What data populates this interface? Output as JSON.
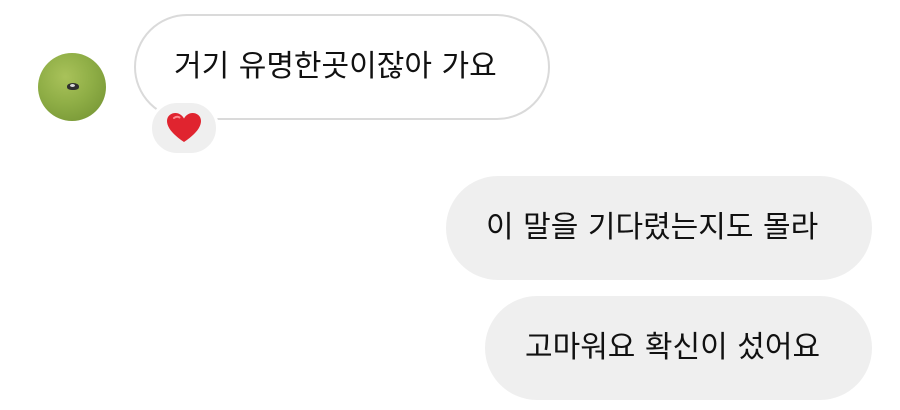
{
  "conversation": {
    "incoming": {
      "text": "거기 유명한곳이잖아 가요",
      "reaction": "heart-icon",
      "reaction_color": "#e0242f"
    },
    "outgoing": [
      {
        "text": "이 말을 기다렸는지도 몰라"
      },
      {
        "text": "고마워요 확신이 섰어요"
      }
    ]
  },
  "colors": {
    "incoming_border": "#dadada",
    "outgoing_background": "#efefef",
    "text": "#111111"
  }
}
